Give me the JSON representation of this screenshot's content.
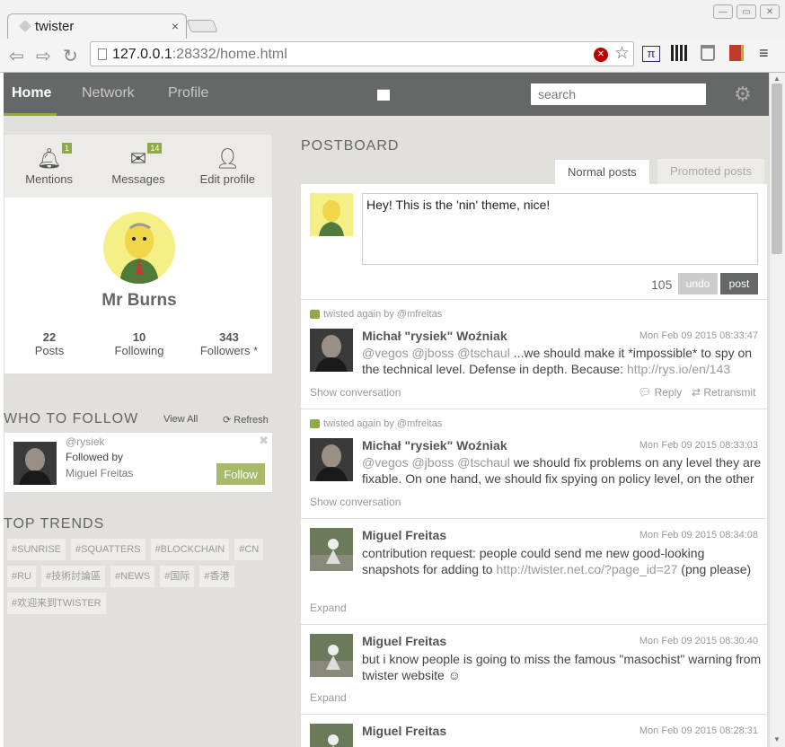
{
  "browser": {
    "tab_title": "twister",
    "url_host": "127.0.0.1",
    "url_rest": ":28332/home.html"
  },
  "nav": {
    "home": "Home",
    "network": "Network",
    "profile": "Profile",
    "search_placeholder": "search"
  },
  "profile": {
    "mentions": "Mentions",
    "mentions_count": "1",
    "messages": "Messages",
    "messages_count": "14",
    "edit": "Edit profile",
    "name": "Mr Burns",
    "posts_n": "22",
    "posts_l": "Posts",
    "following_n": "10",
    "following_l": "Following",
    "followers_n": "343",
    "followers_l": "Followers *"
  },
  "who_to_follow": {
    "title": "WHO TO FOLLOW",
    "view_all": "View All",
    "refresh": "Refresh",
    "user": "@rysiek",
    "followed_by": "Followed by",
    "followed_by_name": "Miguel Freitas",
    "follow": "Follow"
  },
  "trends": {
    "title": "TOP TRENDS",
    "items": [
      "#SUNRISE",
      "#SQUATTERS",
      "#BLOCKCHAIN",
      "#CN",
      "#RU",
      "#技術討論區",
      "#NEWS",
      "#国际",
      "#香港",
      "#欢迎来到TWISTER"
    ]
  },
  "postboard": {
    "title": "POSTBOARD",
    "tab_normal": "Normal posts",
    "tab_promoted": "Promoted posts",
    "compose_text": "Hey! This is the 'nin' theme, nice!",
    "char_count": "105",
    "undo": "undo",
    "post": "post"
  },
  "posts": [
    {
      "retwist": "twisted again by @mfreitas",
      "name": "Michał \"rysiek\" Woźniak",
      "time": "Mon Feb 09 2015 08:33:47",
      "mentions": "@vegos @jboss @tschaul",
      "text": " ...we should make it *impossible* to spy on the technical level. Defense in depth. Because: ",
      "link": "http://rys.io/en/143",
      "foot": "Show conversation",
      "reply": "Reply",
      "retransmit": "Retransmit"
    },
    {
      "retwist": "twisted again by @mfreitas",
      "name": "Michał \"rysiek\" Woźniak",
      "time": "Mon Feb 09 2015 08:33:03",
      "mentions": "@vegos @jboss @tschaul",
      "text": " we should fix problems on any level they are fixable. On one hand, we should fix spying on policy level, on the other",
      "foot": "Show conversation"
    },
    {
      "name": "Miguel Freitas",
      "time": "Mon Feb 09 2015 08:34:08",
      "text": "contribution request: people could send me new good-looking snapshots for adding to ",
      "link": "http://twister.net.co/?page_id=27",
      "text_after": " (png please)",
      "foot": "Expand"
    },
    {
      "name": "Miguel Freitas",
      "time": "Mon Feb 09 2015 08:30:40",
      "text": "but i know people is going to miss the famous \"masochist\" warning from twister website ☺",
      "foot": "Expand"
    },
    {
      "name": "Miguel Freitas",
      "time": "Mon Feb 09 2015 08:28:31"
    }
  ],
  "colors": {
    "accent": "#8daa43",
    "topbar": "#666767",
    "background": "#e1e0dc"
  }
}
